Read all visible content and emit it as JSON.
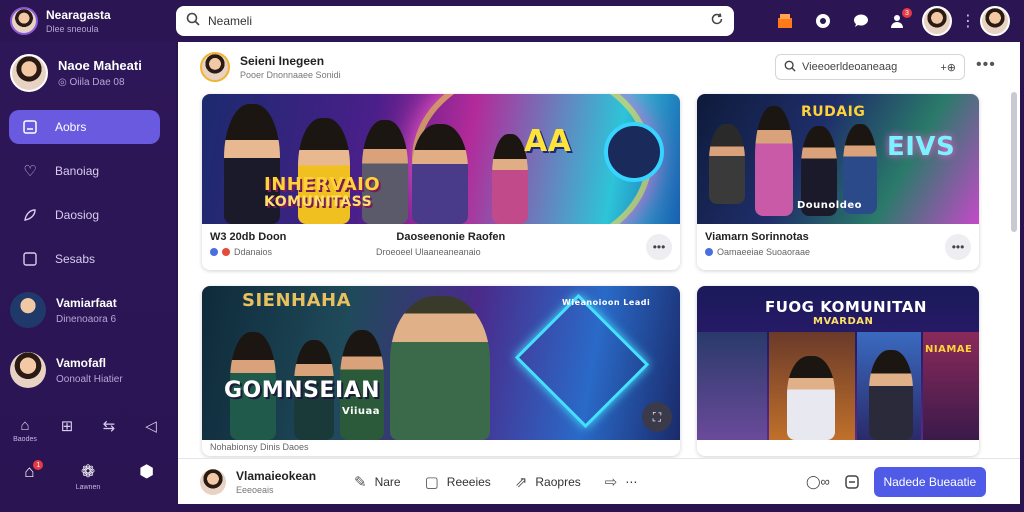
{
  "colors": {
    "sidebar_bg": "#2b1552",
    "accent": "#6a5ae0",
    "primary_button": "#4f5be6",
    "badge": "#e53946"
  },
  "app": {
    "title": "Nearagasta",
    "subtitle": "Dlee sneoula"
  },
  "search": {
    "value": "Neameli",
    "icon": "search-icon",
    "action_icon": "refresh-icon"
  },
  "top_icons": [
    {
      "name": "store-icon",
      "glyph": "⛟"
    },
    {
      "name": "explore-icon",
      "glyph": "◉"
    },
    {
      "name": "chat-icon",
      "glyph": "☁"
    },
    {
      "name": "friends-icon",
      "glyph": "☺",
      "badge": "3"
    }
  ],
  "profile": {
    "name": "Naoe Maheati",
    "status": "Oiila Dae 08"
  },
  "nav": [
    {
      "label": "Aobrs",
      "icon": "edit-icon",
      "active": true
    },
    {
      "label": "Banoiag",
      "icon": "heart-icon",
      "active": false
    },
    {
      "label": "Daosiog",
      "icon": "feather-icon",
      "active": false
    },
    {
      "label": "Sesabs",
      "icon": "square-icon",
      "active": false
    }
  ],
  "contacts": [
    {
      "name": "Vamiarfaat",
      "sub": "Dinenoaora 6"
    },
    {
      "name": "Vamofafl",
      "sub": "Oonoalt Hiatier"
    }
  ],
  "side_tools": [
    {
      "icon": "bell-icon",
      "glyph": "⌂",
      "label": "Baodes"
    },
    {
      "icon": "book-icon",
      "glyph": "⊞",
      "label": ""
    },
    {
      "icon": "share-icon",
      "glyph": "⇆",
      "label": ""
    },
    {
      "icon": "back-icon",
      "glyph": "◁",
      "label": ""
    }
  ],
  "side_bottom": [
    {
      "icon": "home-icon",
      "glyph": "⌂",
      "badge": "1",
      "label": ""
    },
    {
      "icon": "group-icon",
      "glyph": "❁",
      "label": "Lawnen"
    },
    {
      "icon": "settings-icon",
      "glyph": "⬢",
      "label": ""
    }
  ],
  "main": {
    "poster": {
      "name": "Seieni Inegeen",
      "sub": "Pooer Dnonnaaee Sonidi"
    },
    "search_value": "Vieeoerldeoaneaag",
    "search_extra": "+⊕"
  },
  "cards": [
    {
      "title": "W3 20db Doon",
      "title2": "Daoseenonie Raofen",
      "meta": "Ddanaios",
      "meta2": "Droeoeel Ulaaneaneanaio",
      "overlay_1": "INHERVAIO",
      "overlay_2": "KOMUNITASS",
      "overlay_3": "AA"
    },
    {
      "title": "Viamarn Sorinnotas",
      "meta": "Oamaeeiae Suoaoraae",
      "overlay_1": "RUDAIG",
      "overlay_2": "EIVS",
      "overlay_3": "Dounoldeo"
    },
    {
      "title": "Nohabionsy Dinis Daoes",
      "meta": "",
      "overlay_1": "SIENHAHA",
      "overlay_2": "GOMNSEIAN",
      "overlay_3": "Viiuaa",
      "overlay_4": "Wieanoioon Leadi"
    },
    {
      "title": "",
      "meta": "",
      "overlay_1": "FUOG KOMUNITAN",
      "overlay_2": "MVARDAN",
      "overlay_3": "NIAMAE"
    }
  ],
  "bottom": {
    "user": {
      "name": "Vlamaieokean",
      "sub": "Eeeoeais"
    },
    "actions": [
      {
        "icon": "pen-icon",
        "glyph": "✎",
        "label": "Nare"
      },
      {
        "icon": "note-icon",
        "glyph": "▢",
        "label": "Reeeies"
      },
      {
        "icon": "share-icon",
        "glyph": "⇗",
        "label": "Raopres"
      },
      {
        "icon": "forward-icon",
        "glyph": "⇨",
        "label": "⋯"
      }
    ],
    "comment_count": "◯∞",
    "button_label": "Nadede Bueaatie"
  }
}
